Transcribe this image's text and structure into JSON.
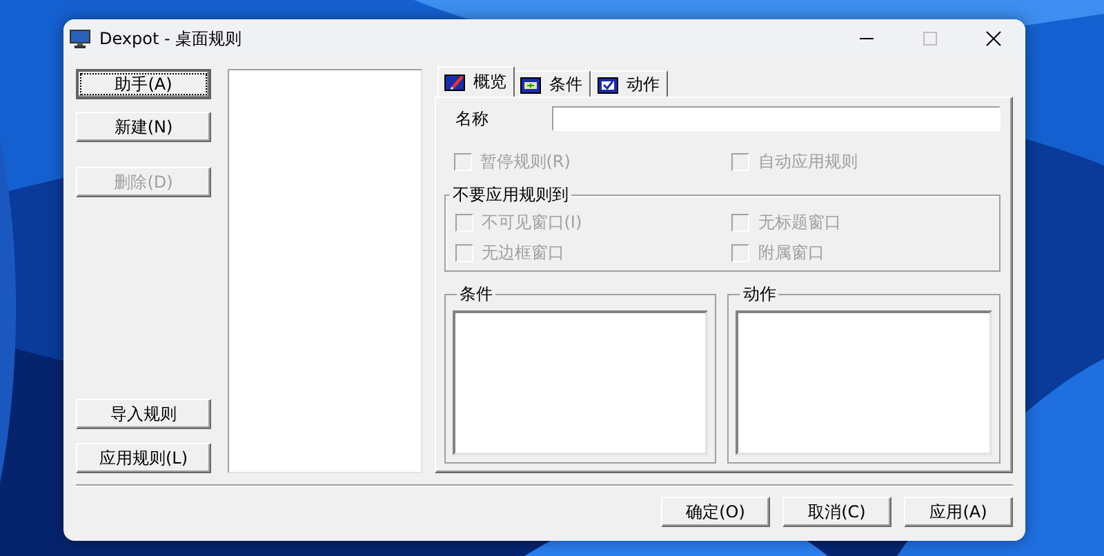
{
  "window": {
    "title": "Dexpot - 桌面规则",
    "maximize_disabled": true
  },
  "side_buttons_top": [
    {
      "label": "助手(A)",
      "disabled": false,
      "focused": true
    },
    {
      "label": "新建(N)",
      "disabled": false,
      "focused": false
    },
    {
      "label": "删除(D)",
      "disabled": true,
      "focused": false
    }
  ],
  "side_buttons_bottom": [
    {
      "label": "导入规则",
      "disabled": false,
      "focused": false
    },
    {
      "label": "应用规则(L)",
      "disabled": false,
      "focused": false
    }
  ],
  "tabs": [
    {
      "label": "概览",
      "selected": true,
      "kind": "overview"
    },
    {
      "label": "条件",
      "selected": false,
      "kind": "condition"
    },
    {
      "label": "动作",
      "selected": false,
      "kind": "action"
    }
  ],
  "name_field": {
    "label": "名称"
  },
  "options": [
    {
      "label": "暂停规则(R)",
      "checked": false,
      "disabled": true
    },
    {
      "label": "自动应用规则",
      "checked": false,
      "disabled": true
    }
  ],
  "exclude_group": {
    "title": "不要应用规则到",
    "options": [
      {
        "label": "不可见窗口(I)",
        "checked": false,
        "disabled": true
      },
      {
        "label": "无标题窗口",
        "checked": false,
        "disabled": true
      },
      {
        "label": "无边框窗口",
        "checked": false,
        "disabled": true
      },
      {
        "label": "附属窗口",
        "checked": false,
        "disabled": true
      }
    ]
  },
  "lists": [
    {
      "title": "条件"
    },
    {
      "title": "动作"
    }
  ],
  "dialog_buttons": [
    "确定(O)",
    "取消(C)",
    "应用(A)"
  ]
}
